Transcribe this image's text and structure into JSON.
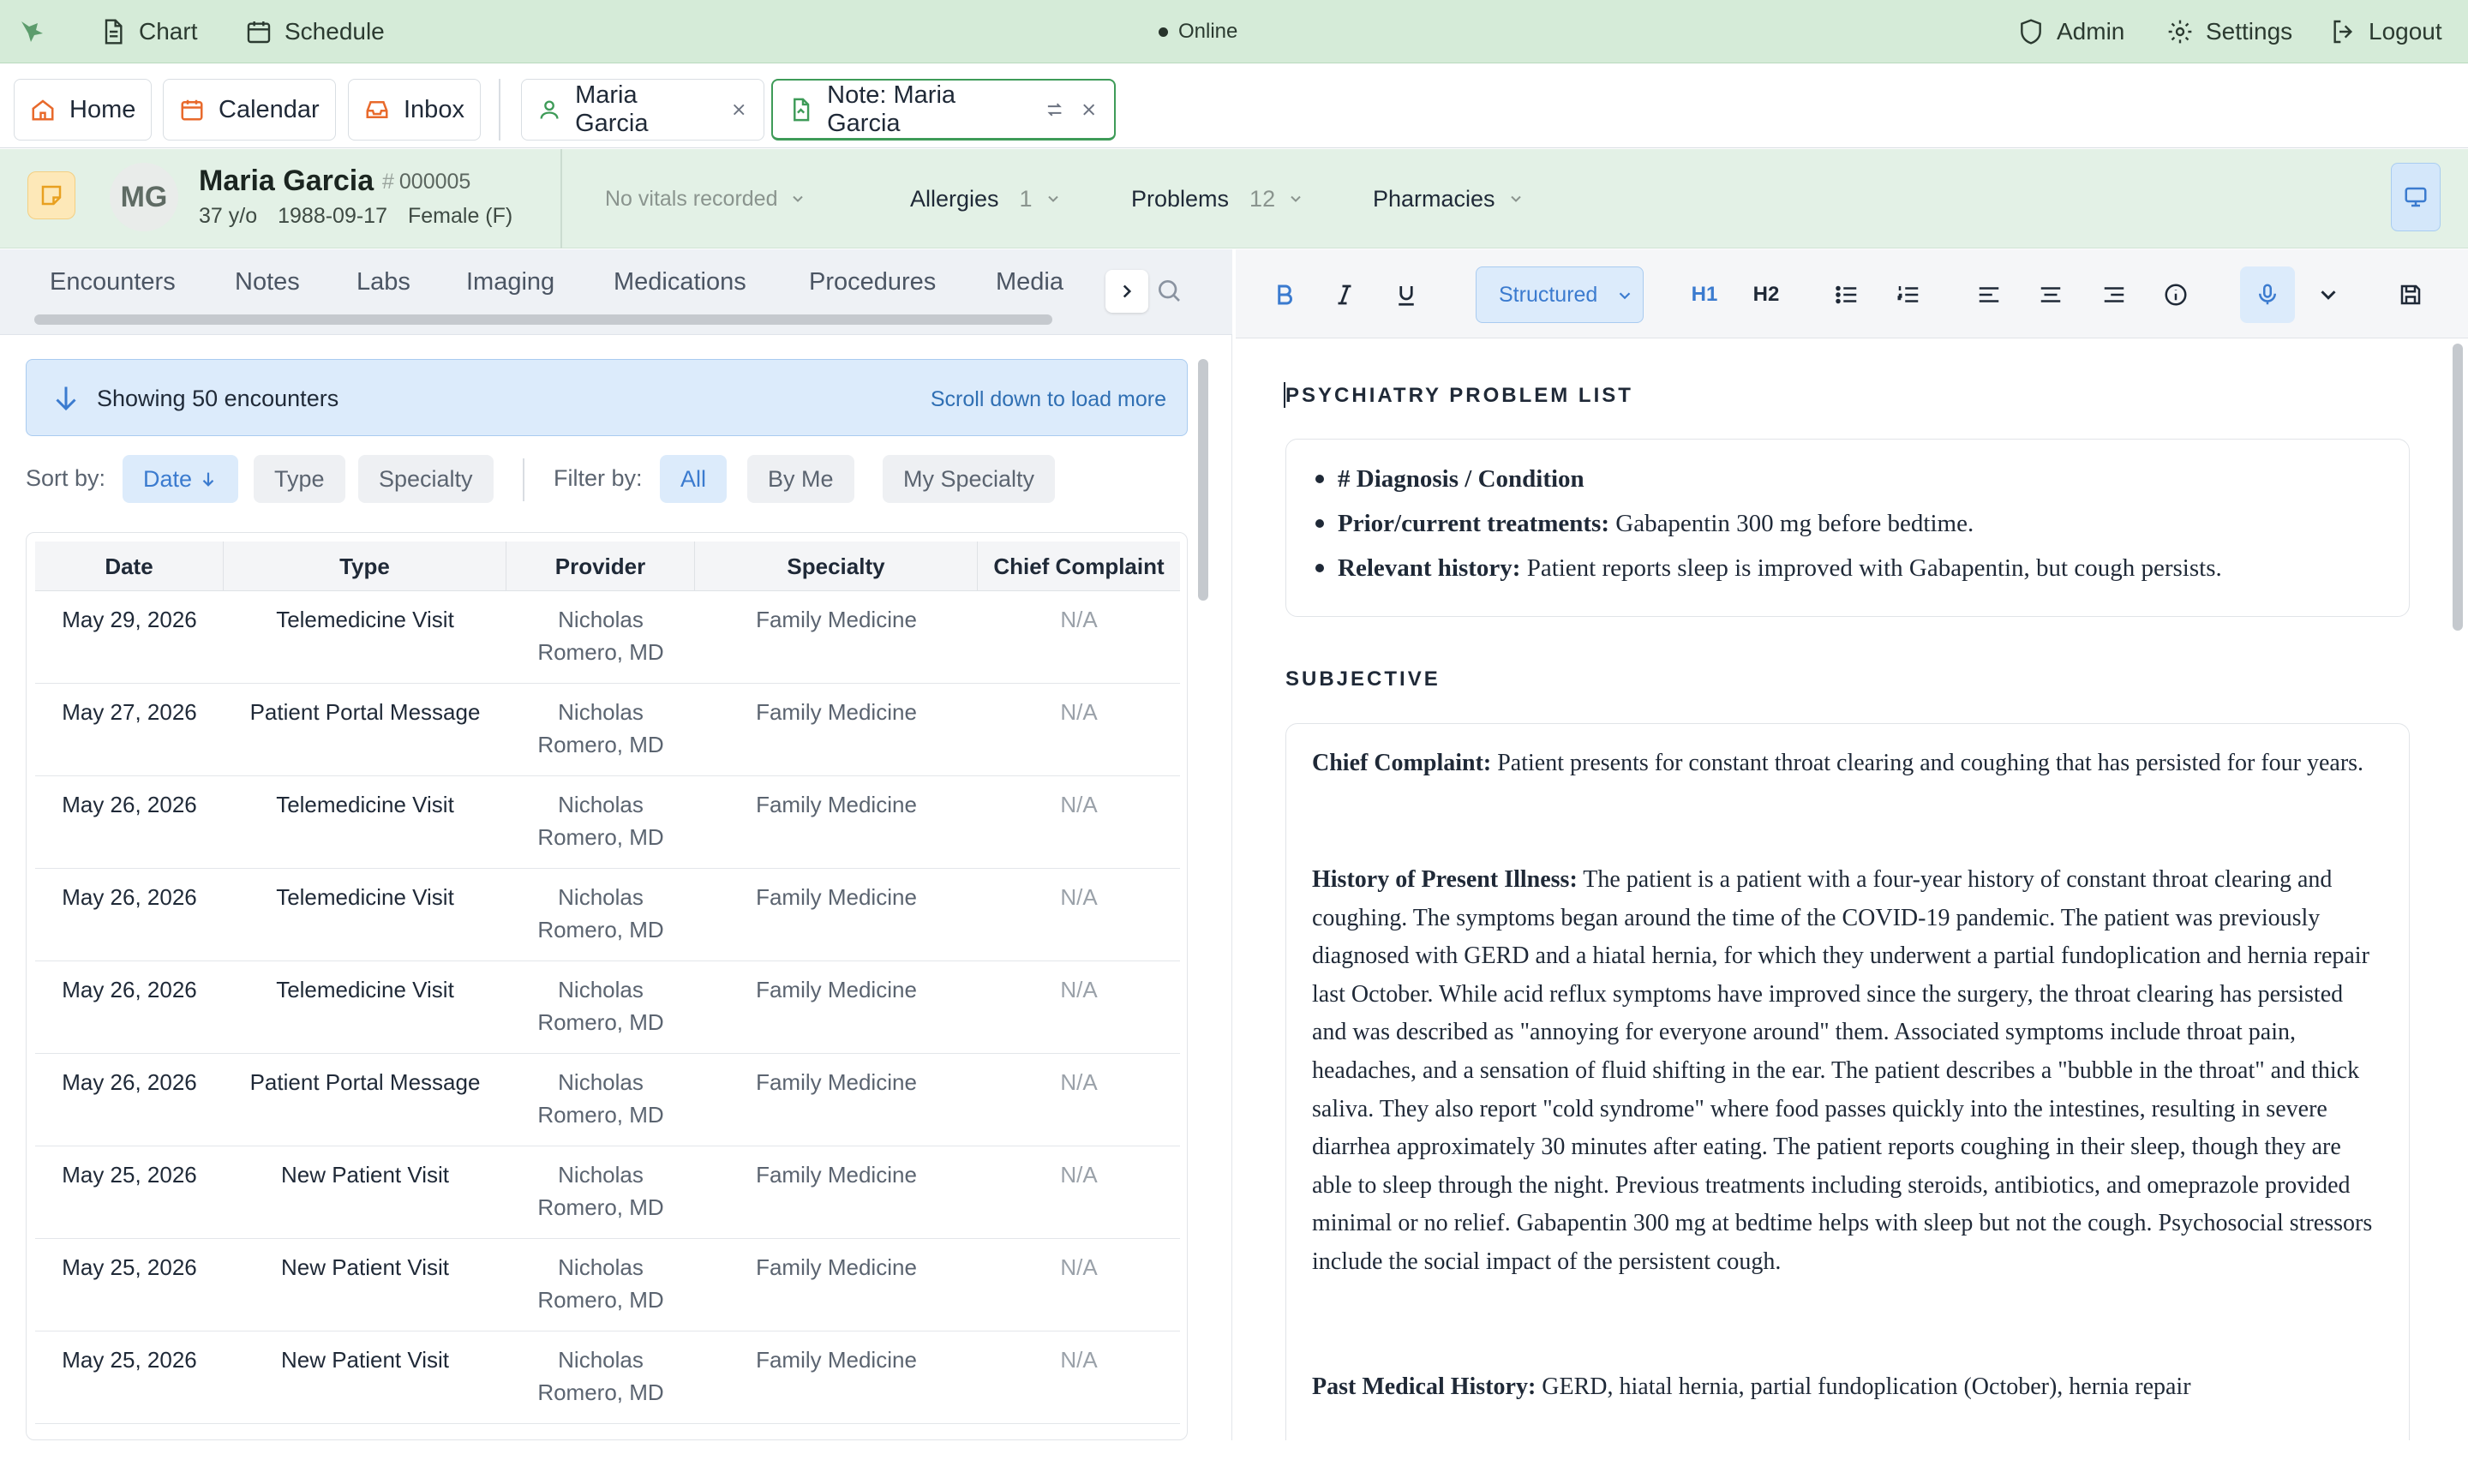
{
  "topbar": {
    "chart": "Chart",
    "schedule": "Schedule",
    "status": "Online",
    "admin": "Admin",
    "settings": "Settings",
    "logout": "Logout"
  },
  "tabs": [
    {
      "label": "Home"
    },
    {
      "label": "Calendar"
    },
    {
      "label": "Inbox"
    },
    {
      "label": "Maria Garcia"
    },
    {
      "label": "Note: Maria Garcia"
    }
  ],
  "patient": {
    "initials": "MG",
    "name": "Maria Garcia",
    "id": "000005",
    "age": "37 y/o",
    "dob": "1988-09-17",
    "sex": "Female (F)",
    "vitals": "No vitals recorded",
    "allergies_label": "Allergies",
    "allergies_count": "1",
    "problems_label": "Problems",
    "problems_count": "12",
    "pharmacies_label": "Pharmacies"
  },
  "left_panel": {
    "subtabs": [
      "Encounters",
      "Notes",
      "Labs",
      "Imaging",
      "Medications",
      "Procedures",
      "Media"
    ],
    "banner_text": "Showing 50 encounters",
    "banner_link": "Scroll down to load more",
    "sort_label": "Sort by:",
    "sort_options": [
      "Date",
      "Type",
      "Specialty"
    ],
    "filter_label": "Filter by:",
    "filter_options": [
      "All",
      "By Me",
      "My Specialty"
    ],
    "columns": [
      "Date",
      "Type",
      "Provider",
      "Specialty",
      "Chief Complaint"
    ],
    "rows": [
      {
        "date": "May 29, 2026",
        "type": "Telemedicine Visit",
        "provider_1": "Nicholas",
        "provider_2": "Romero, MD",
        "specialty": "Family Medicine",
        "complaint": "N/A"
      },
      {
        "date": "May 27, 2026",
        "type": "Patient Portal Message",
        "provider_1": "Nicholas",
        "provider_2": "Romero, MD",
        "specialty": "Family Medicine",
        "complaint": "N/A"
      },
      {
        "date": "May 26, 2026",
        "type": "Telemedicine Visit",
        "provider_1": "Nicholas",
        "provider_2": "Romero, MD",
        "specialty": "Family Medicine",
        "complaint": "N/A"
      },
      {
        "date": "May 26, 2026",
        "type": "Telemedicine Visit",
        "provider_1": "Nicholas",
        "provider_2": "Romero, MD",
        "specialty": "Family Medicine",
        "complaint": "N/A"
      },
      {
        "date": "May 26, 2026",
        "type": "Telemedicine Visit",
        "provider_1": "Nicholas",
        "provider_2": "Romero, MD",
        "specialty": "Family Medicine",
        "complaint": "N/A"
      },
      {
        "date": "May 26, 2026",
        "type": "Patient Portal Message",
        "provider_1": "Nicholas",
        "provider_2": "Romero, MD",
        "specialty": "Family Medicine",
        "complaint": "N/A"
      },
      {
        "date": "May 25, 2026",
        "type": "New Patient Visit",
        "provider_1": "Nicholas",
        "provider_2": "Romero, MD",
        "specialty": "Family Medicine",
        "complaint": "N/A"
      },
      {
        "date": "May 25, 2026",
        "type": "New Patient Visit",
        "provider_1": "Nicholas",
        "provider_2": "Romero, MD",
        "specialty": "Family Medicine",
        "complaint": "N/A"
      },
      {
        "date": "May 25, 2026",
        "type": "New Patient Visit",
        "provider_1": "Nicholas",
        "provider_2": "Romero, MD",
        "specialty": "Family Medicine",
        "complaint": "N/A"
      }
    ]
  },
  "editor": {
    "format_select": "Structured",
    "h1": "H1",
    "h2": "H2",
    "section1_title": "PSYCHIATRY PROBLEM LIST",
    "problem_list": {
      "item1": "# Diagnosis / Condition",
      "item2_label": "Prior/current treatments:",
      "item2_text": " Gabapentin 300 mg before bedtime.",
      "item3_label": "Relevant history:",
      "item3_text": " Patient reports sleep is improved with Gabapentin, but cough persists."
    },
    "section2_title": "SUBJECTIVE",
    "subjective": {
      "cc_label": "Chief Complaint:",
      "cc_text": " Patient presents for constant throat clearing and coughing that has persisted for four years.",
      "hpi_label": "History of Present Illness:",
      "hpi_text": " The patient is a patient with a four-year history of constant throat clearing and coughing. The symptoms began around the time of the COVID-19 pandemic. The patient was previously diagnosed with GERD and a hiatal hernia, for which they underwent a partial fundoplication and hernia repair last October. While acid reflux symptoms have improved since the surgery, the throat clearing has persisted and was described as \"annoying for everyone around\" them. Associated symptoms include throat pain, headaches, and a sensation of fluid shifting in the ear. The patient describes a \"bubble in the throat\" and thick saliva. They also report \"cold syndrome\" where food passes quickly into the intestines, resulting in severe diarrhea approximately 30 minutes after eating. The patient reports coughing in their sleep, though they are able to sleep through the night. Previous treatments including steroids, antibiotics, and omeprazole provided minimal or no relief. Gabapentin 300 mg at bedtime helps with sleep but not the cough. Psychosocial stressors include the social impact of the persistent cough.",
      "pmh_label": "Past Medical History:",
      "pmh_text": " GERD, hiatal hernia, partial fundoplication (October), hernia repair"
    }
  }
}
